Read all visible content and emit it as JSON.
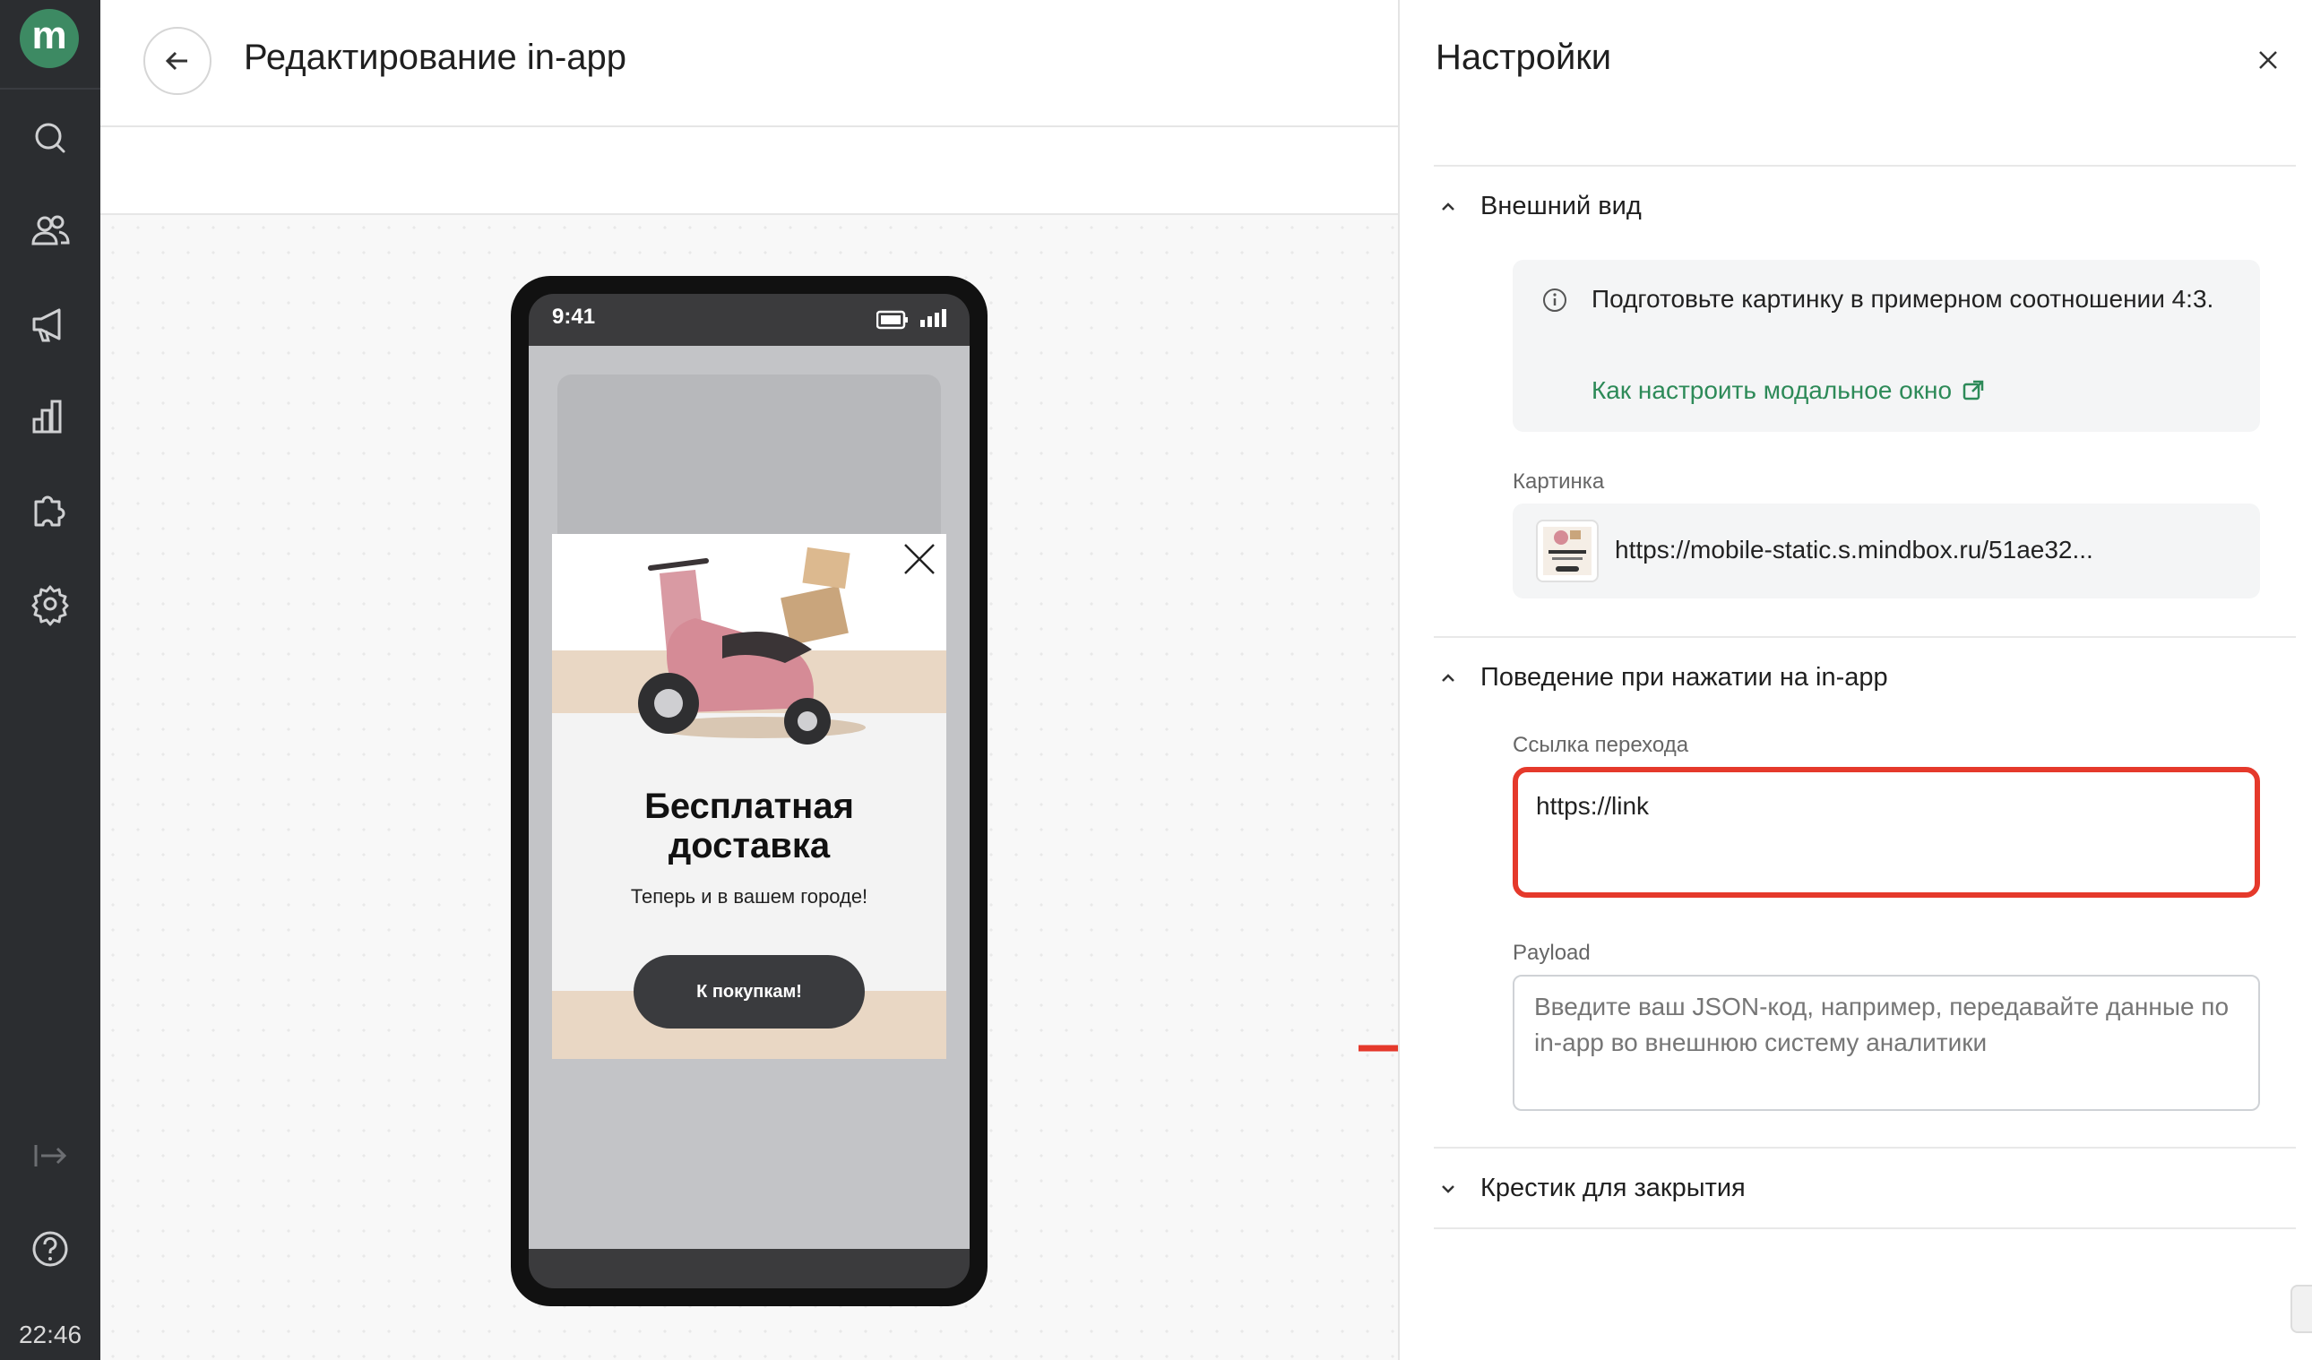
{
  "sidebar": {
    "logo_letter": "m",
    "items": [
      {
        "icon": "search-icon"
      },
      {
        "icon": "users-icon"
      },
      {
        "icon": "megaphone-icon"
      },
      {
        "icon": "bar-chart-icon"
      },
      {
        "icon": "puzzle-icon"
      },
      {
        "icon": "gear-icon"
      }
    ],
    "bottom_items": [
      {
        "icon": "logout-icon"
      },
      {
        "icon": "help-icon"
      }
    ],
    "time": "22:46"
  },
  "header": {
    "title": "Редактирование in-app"
  },
  "preview": {
    "phone_time": "9:41",
    "modal": {
      "title_line1": "Бесплатная",
      "title_line2": "доставка",
      "subtitle": "Теперь и в вашем городе!",
      "button_label": "К покупкам!"
    }
  },
  "settings": {
    "title": "Настройки",
    "appearance": {
      "label": "Внешний вид",
      "info_text": "Подготовьте картинку в примерном соотношении 4:3.",
      "info_link": "Как настроить модальное окно",
      "image_label": "Картинка",
      "image_url": "https://mobile-static.s.mindbox.ru/51ae32..."
    },
    "behavior": {
      "label": "Поведение при нажатии на in-app",
      "link_label": "Ссылка перехода",
      "link_value": "https://link",
      "payload_label": "Payload",
      "payload_placeholder": "Введите ваш JSON-код, например, передавайте данные по in-app во внешнюю систему аналитики"
    },
    "close_cross": {
      "label": "Крестик для закрытия"
    }
  },
  "colors": {
    "sidebar_bg": "#2b2d30",
    "logo": "#3d8a63",
    "link": "#2d8a58",
    "highlight": "#e5392b"
  }
}
